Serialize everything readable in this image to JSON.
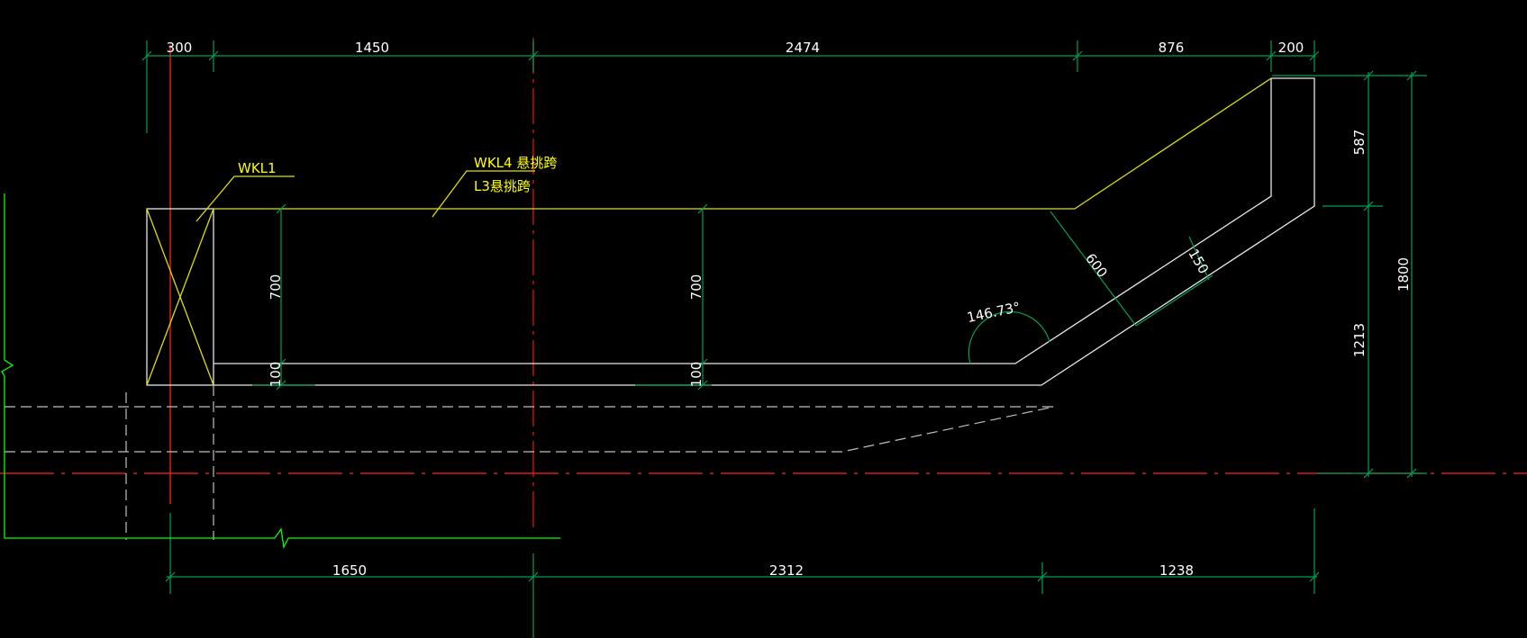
{
  "colors": {
    "background": "#000000",
    "dimension": "#00a050",
    "outline": "#e8e8e8",
    "beam_label": "#ffff00",
    "axis": "#ff2020",
    "break_line": "#00ff00"
  },
  "top_dimensions": [
    "300",
    "1450",
    "2474",
    "876",
    "200"
  ],
  "bottom_dimensions": [
    "1650",
    "2312",
    "1238"
  ],
  "right_dimensions": [
    "587",
    "1213",
    "1800"
  ],
  "inner_dimensions": {
    "depth_left": "700",
    "cover_left": "100",
    "depth_mid": "700",
    "cover_mid": "100",
    "slope_depth": "600",
    "slope_offset": "150",
    "angle": "146.73°"
  },
  "labels": {
    "wkl1": "WKL1",
    "wkl4": "WKL4 悬挑跨",
    "l3": "L3悬挑跨"
  }
}
